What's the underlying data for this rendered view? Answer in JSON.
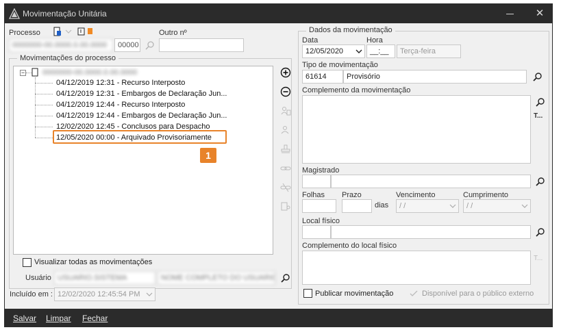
{
  "window": {
    "title": "Movimentação Unitária",
    "close_glyph": "✕"
  },
  "left": {
    "processo_label": "Processo",
    "processo_value": "0000000-00.0000.0.00.0000",
    "processo_suffix": "00000",
    "outro_label": "Outro nº",
    "outro_value": "",
    "movimentacoes_label": "Movimentações do processo",
    "tree_root": "0000000-00.0000.0.00.0000",
    "items": [
      "04/12/2019 12:31 - Recurso Interposto",
      "04/12/2019 12:31 - Embargos de Declaração Jun...",
      "04/12/2019 12:44 - Recurso Interposto",
      "04/12/2019 12:44 - Embargos de Declaração Jun...",
      "12/02/2020 12:45 - Conclusos para Despacho",
      "12/05/2020 00:00 - Arquivado Provisoriamente"
    ],
    "badge": "1",
    "visualizar_label": "Visualizar todas as movimentações",
    "usuario_label": "Usuário",
    "usuario_value": "USUARIO.SISTEMA",
    "usuario_name": "NOME COMPLETO DO USUARIO",
    "incluido_label": "Incluído em :",
    "incluido_value": "12/02/2020 12:45:54 PM"
  },
  "right": {
    "group_title": "Dados da movimentação",
    "data_label": "Data",
    "data_value": "12/05/2020",
    "hora_label": "Hora",
    "hora_value": "__:__",
    "weekday": "Terça-feira",
    "tipo_label": "Tipo de movimentação",
    "tipo_code": "61614",
    "tipo_value": "Provisório",
    "complemento_label": "Complemento da movimentação",
    "t_label": "T...",
    "magistrado_label": "Magistrado",
    "folhas_label": "Folhas",
    "prazo_label": "Prazo",
    "dias_label": "dias",
    "vencimento_label": "Vencimento",
    "vencimento_value": "/ /",
    "cumprimento_label": "Cumprimento",
    "cumprimento_value": "/ /",
    "local_label": "Local físico",
    "comp_local_label": "Complemento do local físico",
    "t2_label": "T...",
    "publicar_label": "Publicar movimentação",
    "disponivel_label": "Disponível para o público externo"
  },
  "footer": {
    "salvar": "Salvar",
    "limpar": "Limpar",
    "fechar": "Fechar"
  }
}
